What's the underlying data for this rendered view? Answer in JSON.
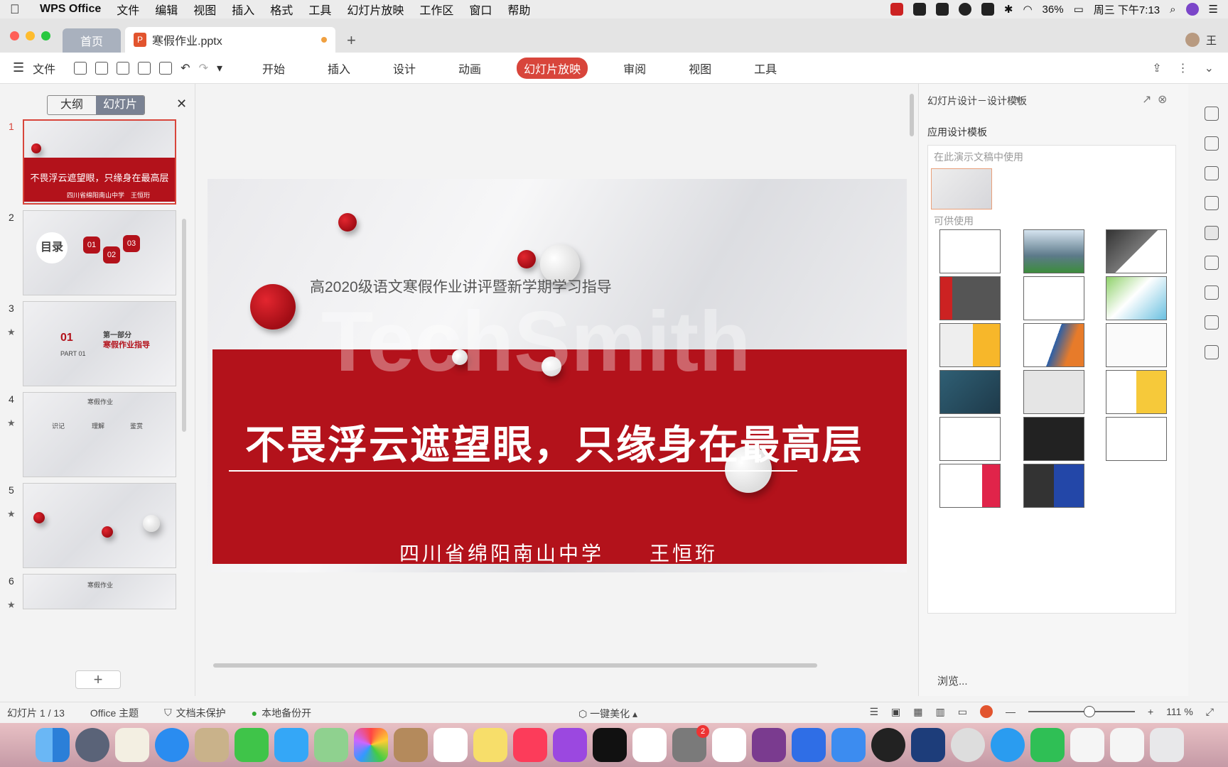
{
  "menubar": {
    "app_name": "WPS Office",
    "items": [
      "文件",
      "编辑",
      "视图",
      "插入",
      "格式",
      "工具",
      "幻灯片放映",
      "工作区",
      "窗口",
      "帮助"
    ],
    "battery": "36%",
    "clock": "周三 下午7:13"
  },
  "tabs": {
    "home": "首页",
    "doc_name": "寒假作业.pptx",
    "user": "王"
  },
  "ribbon": {
    "file": "文件",
    "tabs": [
      "开始",
      "插入",
      "设计",
      "动画",
      "幻灯片放映",
      "审阅",
      "视图",
      "工具"
    ],
    "active_tab": "幻灯片放映"
  },
  "left_panel": {
    "outline": "大纲",
    "slides": "幻灯片",
    "thumbnails": [
      {
        "num": "1",
        "title": "不畏浮云遮望眼，只缘身在最高层",
        "caption": "四川省绵阳南山中学　王恒珩"
      },
      {
        "num": "2",
        "title": "目录",
        "items": [
          "01",
          "02",
          "03"
        ]
      },
      {
        "num": "3",
        "title": "01",
        "part": "第一部分",
        "heading": "寒假作业指导",
        "small": "PART 01"
      },
      {
        "num": "4",
        "title": "寒假作业",
        "steps": [
          "识记",
          "理解",
          "鉴赏"
        ]
      },
      {
        "num": "5",
        "title": ""
      },
      {
        "num": "6",
        "title": "寒假作业"
      }
    ]
  },
  "slide": {
    "subtitle": "高2020级语文寒假作业讲评暨新学期学习指导",
    "title": "不畏浮云遮望眼，只缘身在最高层",
    "author": "四川省绵阳南山中学　　王恒珩",
    "watermark": "TechSmith"
  },
  "right_panel": {
    "title": "幻灯片设计－设计模板",
    "section": "应用设计模板",
    "in_use": "在此演示文稿中使用",
    "available": "可供使用",
    "browse": "浏览..."
  },
  "status": {
    "slide_info": "幻灯片 1 / 13",
    "theme": "Office 主题",
    "protect": "文档未保护",
    "backup": "本地备份开",
    "beautify": "一键美化",
    "zoom": "111 %"
  },
  "dock": {
    "badges": [
      "2"
    ]
  }
}
